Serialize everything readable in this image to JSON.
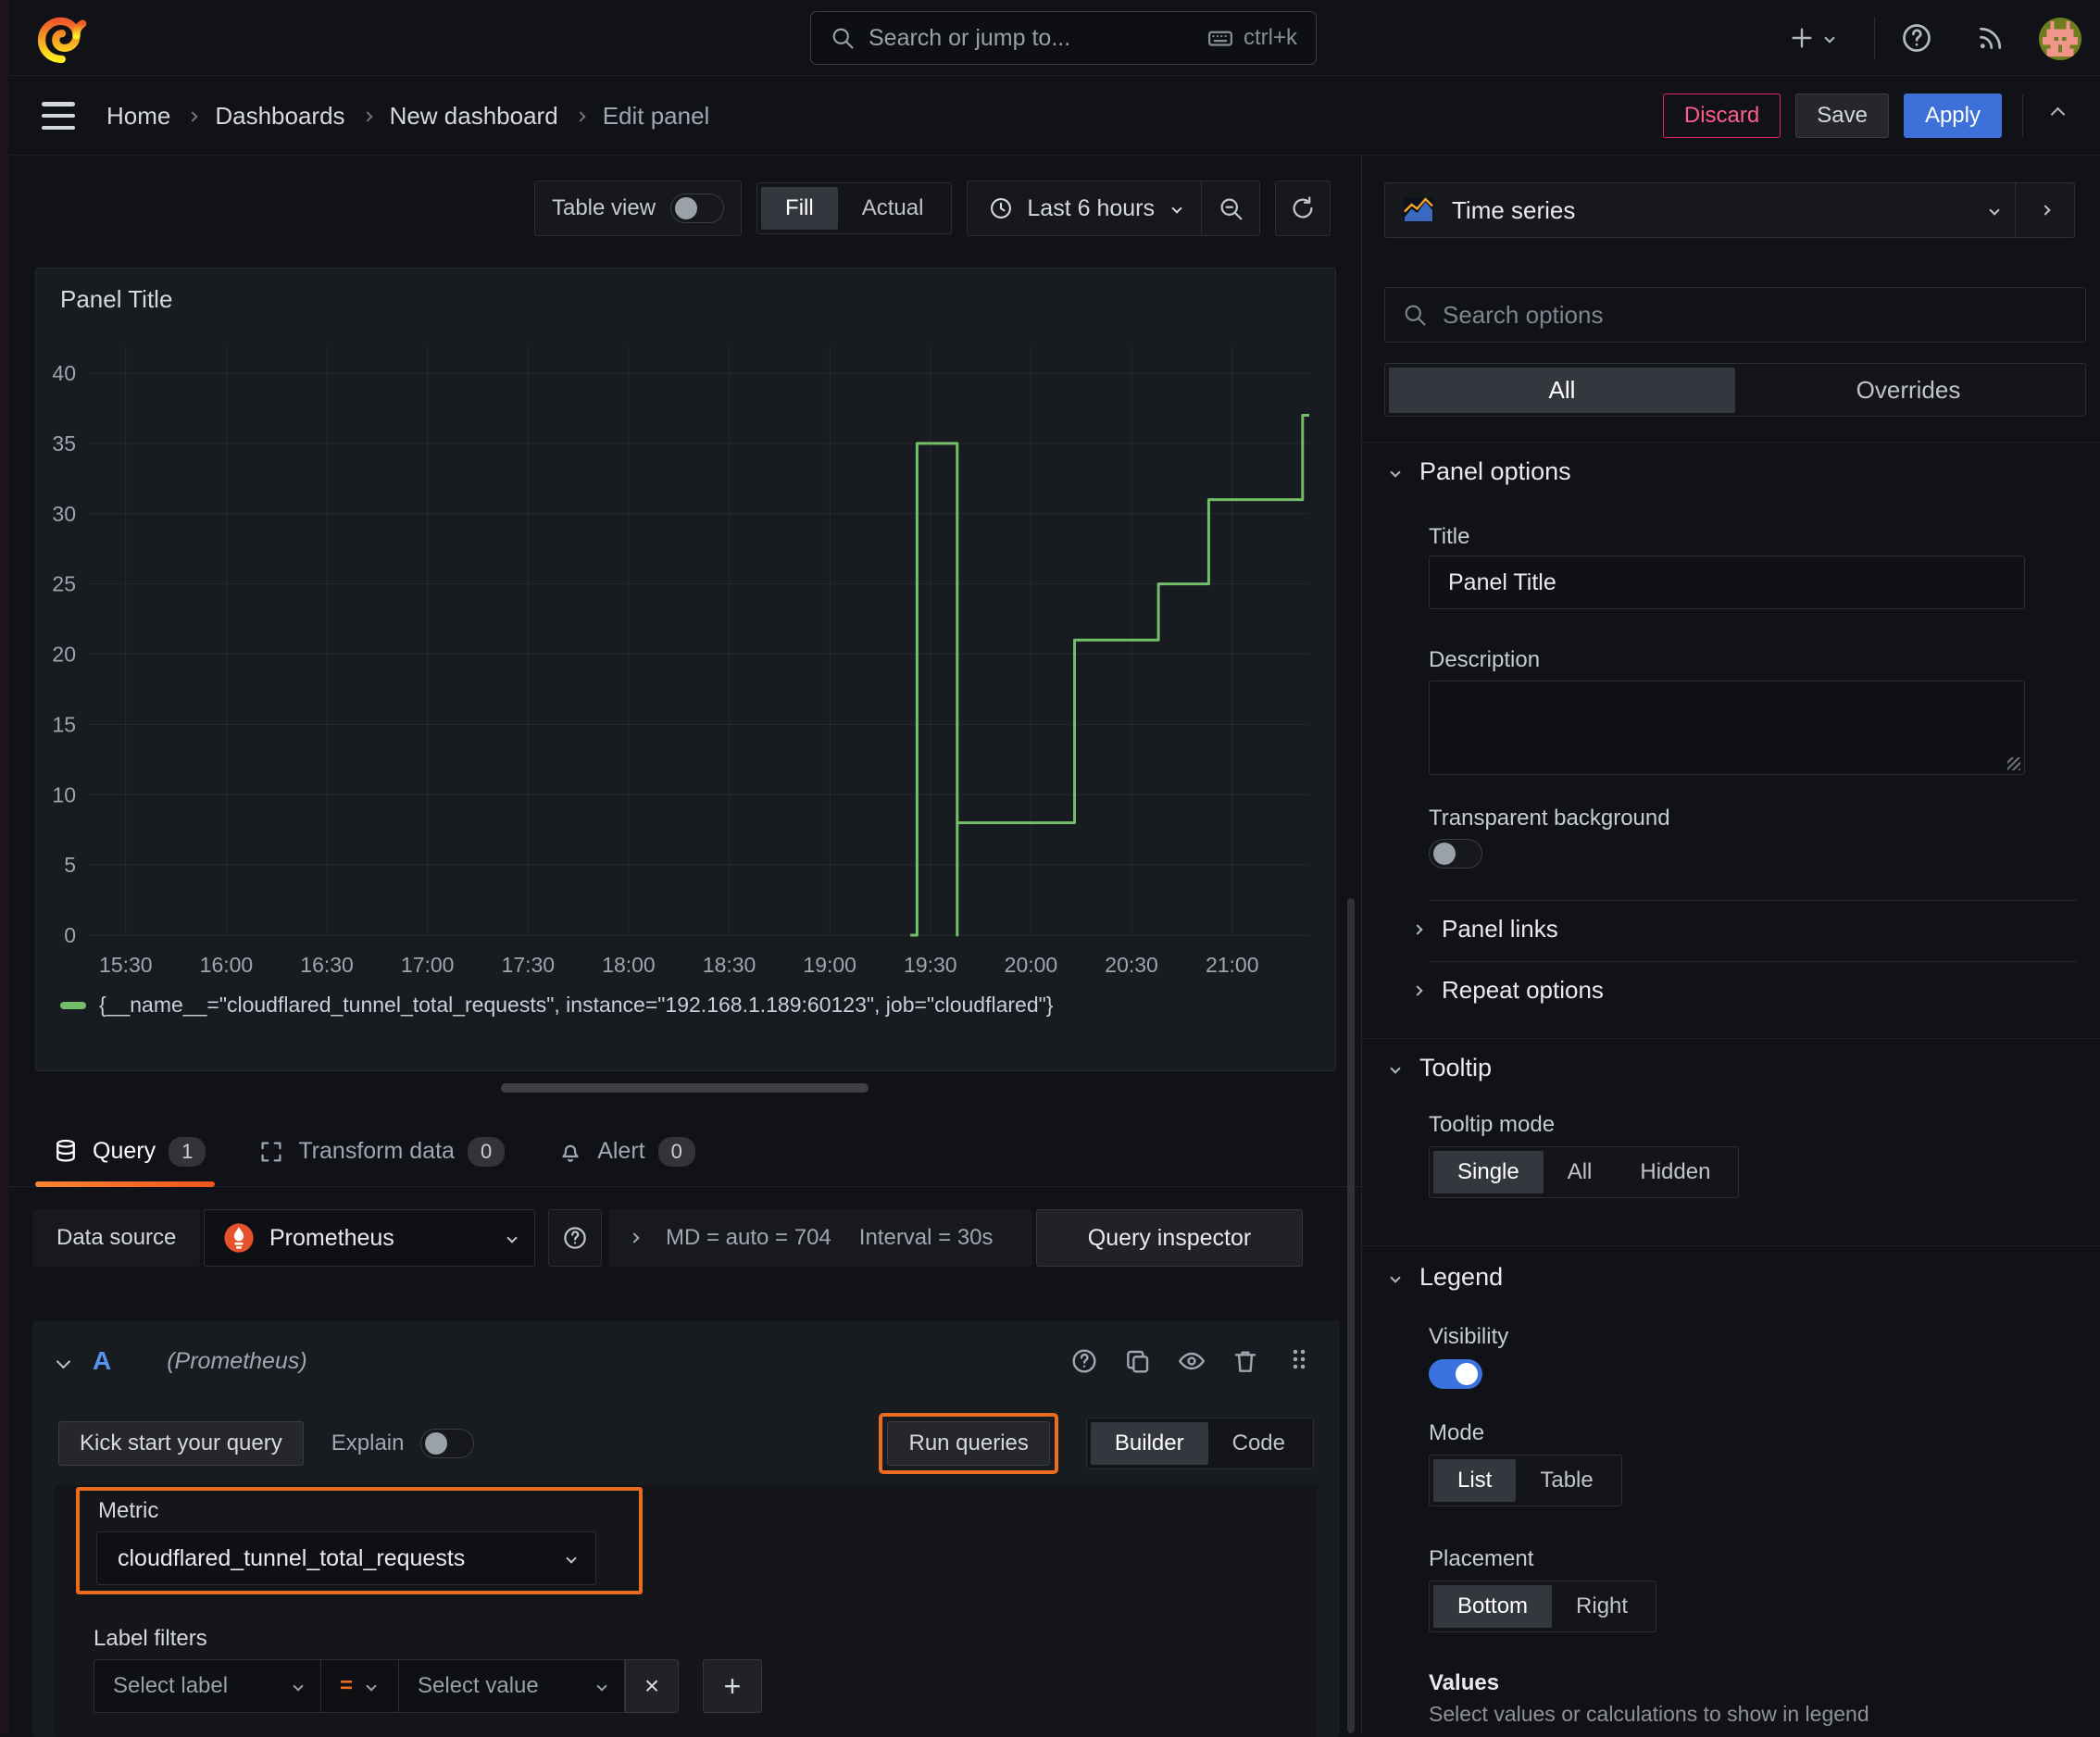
{
  "app": {
    "search_placeholder": "Search or jump to...",
    "search_shortcut": "ctrl+k"
  },
  "breadcrumb": {
    "items": [
      "Home",
      "Dashboards",
      "New dashboard",
      "Edit panel"
    ]
  },
  "actions": {
    "discard": "Discard",
    "save": "Save",
    "apply": "Apply"
  },
  "toolbar": {
    "table_view": "Table view",
    "fill": "Fill",
    "actual": "Actual",
    "time_range": "Last 6 hours"
  },
  "panel": {
    "title": "Panel Title"
  },
  "chart_data": {
    "type": "line",
    "title": "Panel Title",
    "x_ticks": [
      "15:30",
      "16:00",
      "16:30",
      "17:00",
      "17:30",
      "18:00",
      "18:30",
      "19:00",
      "19:30",
      "20:00",
      "20:30",
      "21:00"
    ],
    "y_ticks": [
      0,
      5,
      10,
      15,
      20,
      25,
      30,
      35,
      40
    ],
    "ylim": [
      0,
      42
    ],
    "x_domain": [
      "15:19",
      "21:23"
    ],
    "grid": true,
    "legend_position": "bottom",
    "series": [
      {
        "name": "{__name__=\"cloudflared_tunnel_total_requests\", instance=\"192.168.1.189:60123\", job=\"cloudflared\"}",
        "color": "#73bf69",
        "points": [
          [
            "19:24",
            0
          ],
          [
            "19:26",
            0
          ],
          [
            "19:26",
            35
          ],
          [
            "19:38",
            35
          ],
          [
            "19:38",
            0
          ],
          [
            "19:38",
            8
          ],
          [
            "20:13",
            8
          ],
          [
            "20:13",
            21
          ],
          [
            "20:38",
            21
          ],
          [
            "20:38",
            25
          ],
          [
            "20:53",
            25
          ],
          [
            "20:53",
            31
          ],
          [
            "21:21",
            31
          ],
          [
            "21:21",
            37
          ],
          [
            "21:23",
            37
          ]
        ]
      }
    ]
  },
  "tabs": {
    "query": "Query",
    "query_count": "1",
    "transform": "Transform data",
    "transform_count": "0",
    "alert": "Alert",
    "alert_count": "0"
  },
  "datasource": {
    "label": "Data source",
    "name": "Prometheus",
    "stat_md": "MD = auto = 704",
    "stat_interval": "Interval = 30s",
    "inspector": "Query inspector"
  },
  "query": {
    "ref_id": "A",
    "ds_hint": "(Prometheus)",
    "kickstart": "Kick start your query",
    "explain": "Explain",
    "run": "Run queries",
    "builder": "Builder",
    "code": "Code",
    "metric_label": "Metric",
    "metric_value": "cloudflared_tunnel_total_requests",
    "label_filters": "Label filters",
    "select_label": "Select label",
    "equals": "=",
    "select_value": "Select value"
  },
  "viz": {
    "name": "Time series"
  },
  "options": {
    "search_placeholder": "Search options",
    "tab_all": "All",
    "tab_overrides": "Overrides",
    "panel_options": "Panel options",
    "title_label": "Title",
    "description_label": "Description",
    "transparent": "Transparent background",
    "panel_links": "Panel links",
    "repeat_options": "Repeat options",
    "tooltip": "Tooltip",
    "tooltip_mode": "Tooltip mode",
    "single": "Single",
    "all": "All",
    "hidden": "Hidden",
    "legend": "Legend",
    "visibility": "Visibility",
    "mode": "Mode",
    "list": "List",
    "table": "Table",
    "placement": "Placement",
    "bottom": "Bottom",
    "right": "Right",
    "values": "Values",
    "values_hint": "Select values or calculations to show in legend"
  },
  "colors": {
    "accent_orange": "#eb6c1f",
    "series_green": "#73bf69",
    "apply_blue": "#3d71d9",
    "discard_pink": "#e0226e",
    "refid_blue": "#5794f2"
  }
}
